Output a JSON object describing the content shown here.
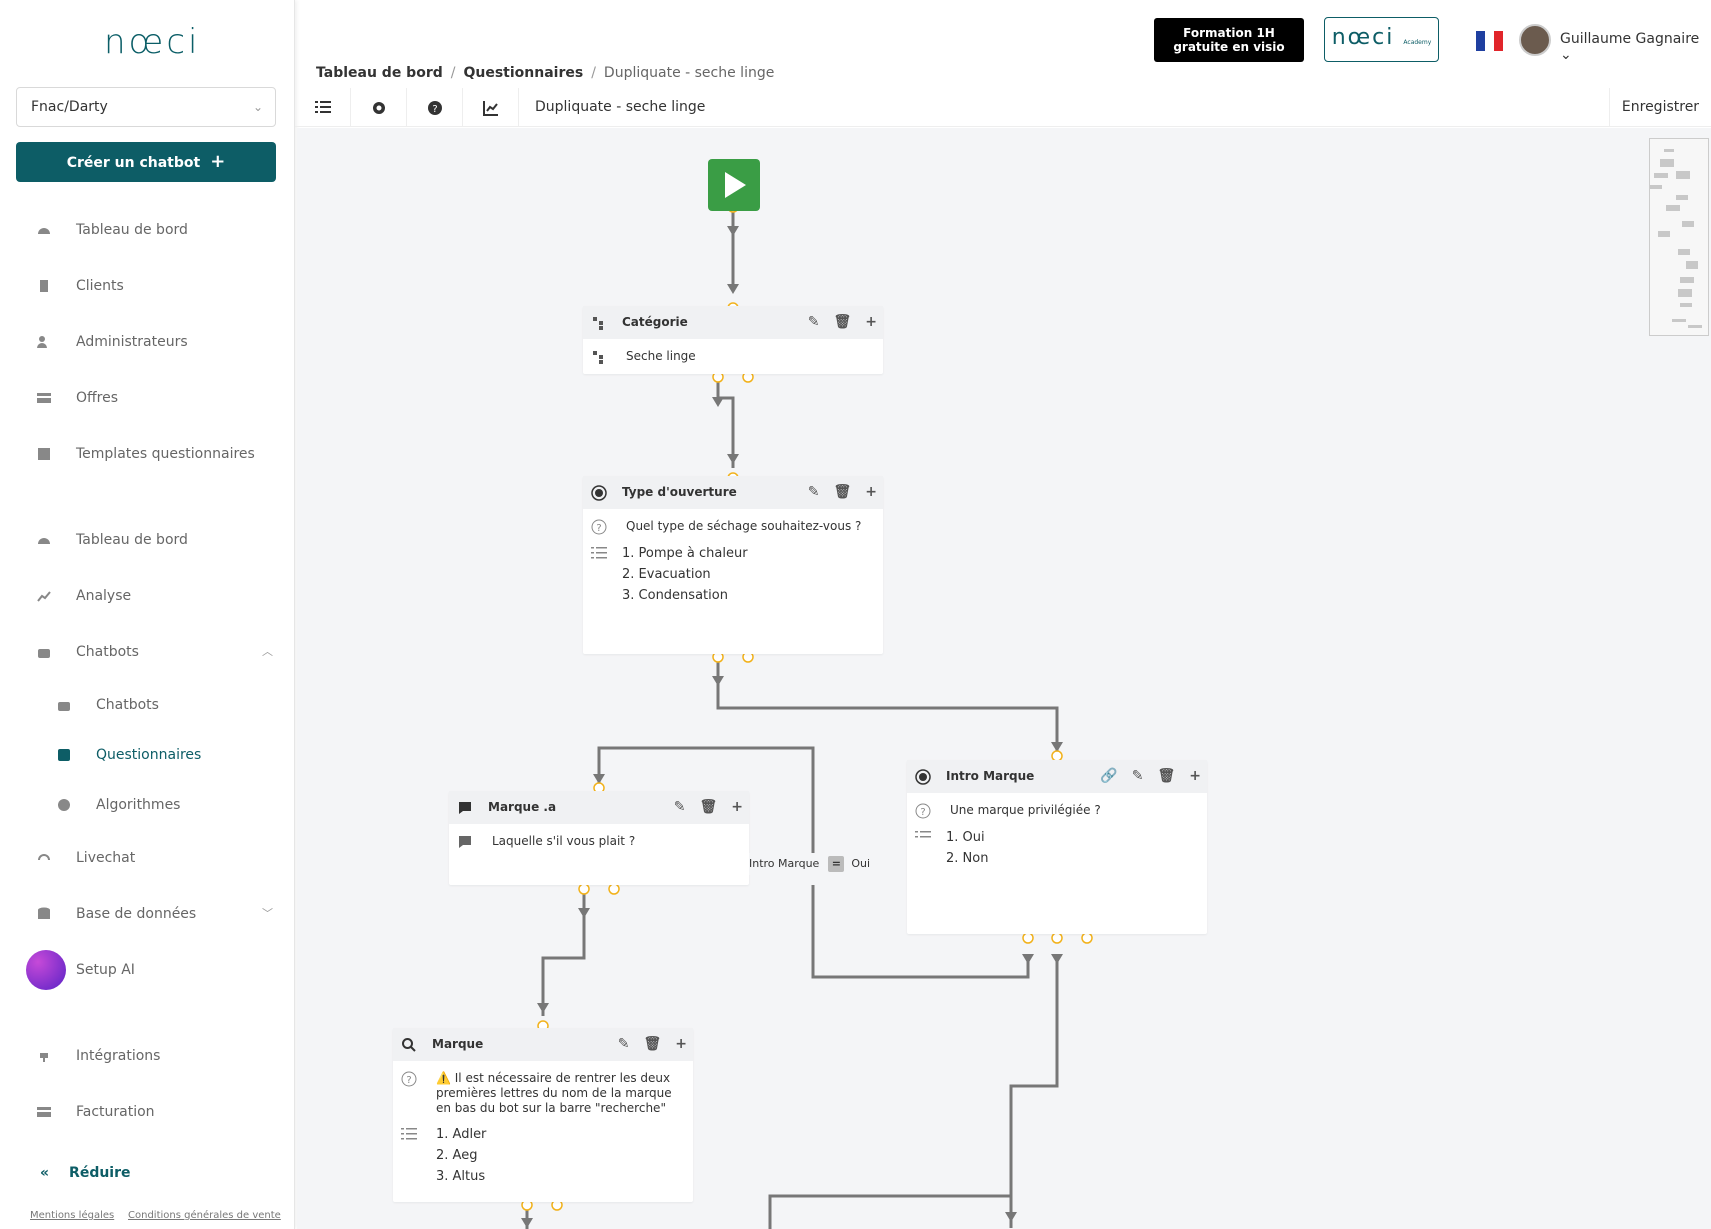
{
  "brand": {
    "logo_text": "nœci",
    "accent": "#0d5d66"
  },
  "client_select": {
    "value": "Fnac/Darty"
  },
  "create_button": {
    "label": "Créer un chatbot",
    "icon": "plus-icon"
  },
  "sidebar": {
    "items": [
      {
        "label": "Tableau de bord",
        "icon": "dashboard-icon"
      },
      {
        "label": "Clients",
        "icon": "building-icon"
      },
      {
        "label": "Administrateurs",
        "icon": "admin-user-icon"
      },
      {
        "label": "Offres",
        "icon": "credit-card-icon"
      },
      {
        "label": "Templates questionnaires",
        "icon": "template-icon"
      },
      {
        "label": "Tableau de bord",
        "icon": "dashboard-icon"
      },
      {
        "label": "Analyse",
        "icon": "chart-line-icon"
      },
      {
        "label": "Chatbots",
        "icon": "robot-icon"
      },
      {
        "label": "Chatbots",
        "icon": "robot-icon"
      },
      {
        "label": "Questionnaires",
        "icon": "form-icon"
      },
      {
        "label": "Algorithmes",
        "icon": "brain-icon"
      },
      {
        "label": "Livechat",
        "icon": "headset-icon"
      },
      {
        "label": "Base de données",
        "icon": "database-icon"
      },
      {
        "label": "Setup AI",
        "icon": "magic-wand-icon"
      },
      {
        "label": "Intégrations",
        "icon": "plug-icon"
      },
      {
        "label": "Facturation",
        "icon": "credit-card-icon"
      }
    ],
    "reduce_label": "Réduire",
    "legal": [
      "Mentions légales",
      "Conditions générales de vente"
    ]
  },
  "header": {
    "formation_button": "Formation 1H gratuite en visio",
    "academy_label": "nœci",
    "academy_small": "Academy",
    "user_name": "Guillaume Gagnaire"
  },
  "breadcrumb": {
    "items": [
      "Tableau de bord",
      "Questionnaires",
      "Dupliquate - seche linge"
    ]
  },
  "toolbar": {
    "title": "Dupliquate - seche linge",
    "save_label": "Enregistrer",
    "buttons": [
      "list-icon",
      "gear-icon",
      "help-icon",
      "chart-icon"
    ]
  },
  "flow": {
    "nodes": {
      "categorie": {
        "title": "Catégorie",
        "content": "Seche linge"
      },
      "type_ouverture": {
        "title": "Type d'ouverture",
        "question": "Quel type de séchage souhaitez-vous ?",
        "options": [
          "1. Pompe à chaleur",
          "2. Evacuation",
          "3. Condensation"
        ]
      },
      "intro_marque": {
        "title": "Intro Marque",
        "question": "Une marque privilégiée ?",
        "options": [
          "1. Oui",
          "2. Non"
        ]
      },
      "marque_a": {
        "title": "Marque .a",
        "content": "Laquelle s'il vous plait ?"
      },
      "marque": {
        "title": "Marque",
        "warning": "⚠️ Il est nécessaire de rentrer les deux premières lettres du nom de la marque en bas du bot sur la barre \"recherche\"",
        "options": [
          "1. Adler",
          "2. Aeg",
          "3. Altus"
        ]
      }
    },
    "condition": {
      "left": "Intro Marque",
      "operator": "=",
      "right": "Oui"
    }
  }
}
